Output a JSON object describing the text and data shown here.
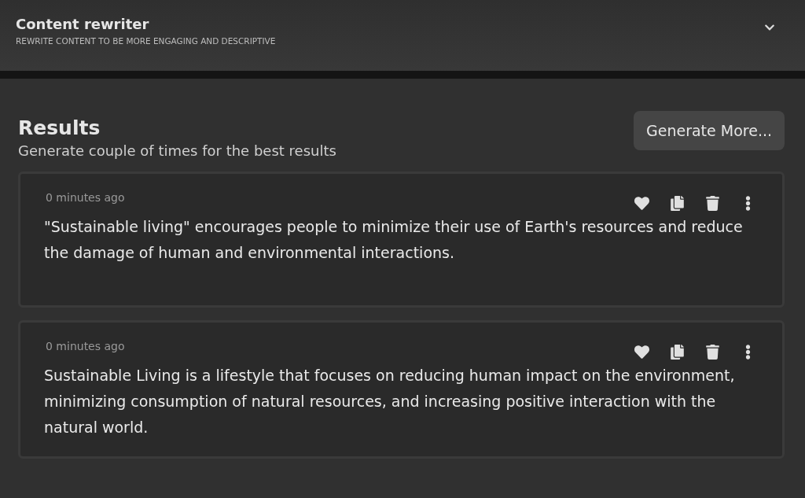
{
  "header": {
    "title": "Content rewriter",
    "subtitle": "REWRITE CONTENT TO BE MORE ENGAGING AND DESCRIPTIVE"
  },
  "results": {
    "title": "Results",
    "subtitle": "Generate couple of times for the best results",
    "button": "Generate More..."
  },
  "items": [
    {
      "time": "0 minutes ago",
      "text": "\"Sustainable living\" encourages people to minimize their use of Earth's resources and reduce the damage of human and environmental interactions."
    },
    {
      "time": "0 minutes ago",
      "text": "Sustainable Living is a lifestyle that focuses on reducing human impact on the environment, minimizing consumption of natural resources, and increasing positive interaction with the natural world."
    }
  ]
}
